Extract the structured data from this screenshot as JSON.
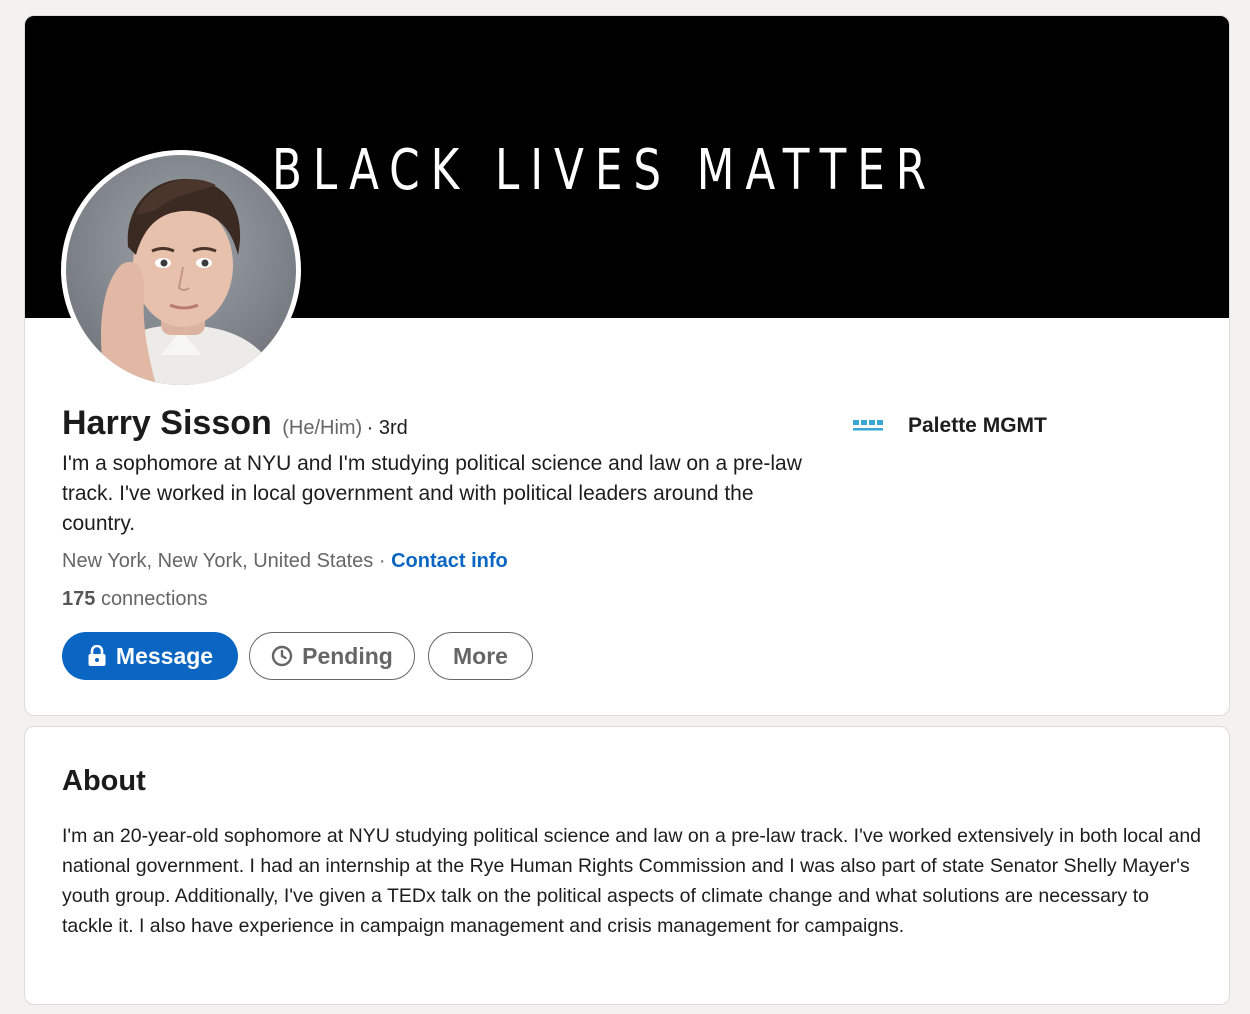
{
  "profile": {
    "banner_text": "BLACK LIVES MATTER",
    "name": "Harry Sisson",
    "pronouns": "(He/Him)",
    "connection_degree": "· 3rd",
    "headline": "I'm a sophomore at NYU and I'm studying political science and law on a pre-law track. I've worked in local government and with political leaders around the country.",
    "location": "New York, New York, United States",
    "location_separator": "·",
    "contact_link": "Contact info",
    "connections_count": "175",
    "connections_label": "connections",
    "company_name": "Palette MGMT"
  },
  "actions": {
    "message_label": "Message",
    "pending_label": "Pending",
    "more_label": "More"
  },
  "about": {
    "title": "About",
    "text": "I'm an 20-year-old sophomore at NYU studying political science and law on a pre-law track. I've worked extensively in both local and national government. I had an internship at the Rye Human Rights Commission and I was also part of state Senator Shelly Mayer's youth group. Additionally, I've given a TEDx talk on the political aspects of climate change and what solutions are necessary to tackle it. I also have experience in campaign management and crisis management for campaigns."
  },
  "colors": {
    "accent": "#0a66c2",
    "banner": "#000000",
    "page_background": "#f3f2ef",
    "company_logo": "#3aa6d8"
  },
  "icons": {
    "message": "lock-icon",
    "pending": "clock-icon",
    "company": "palette-logo"
  }
}
